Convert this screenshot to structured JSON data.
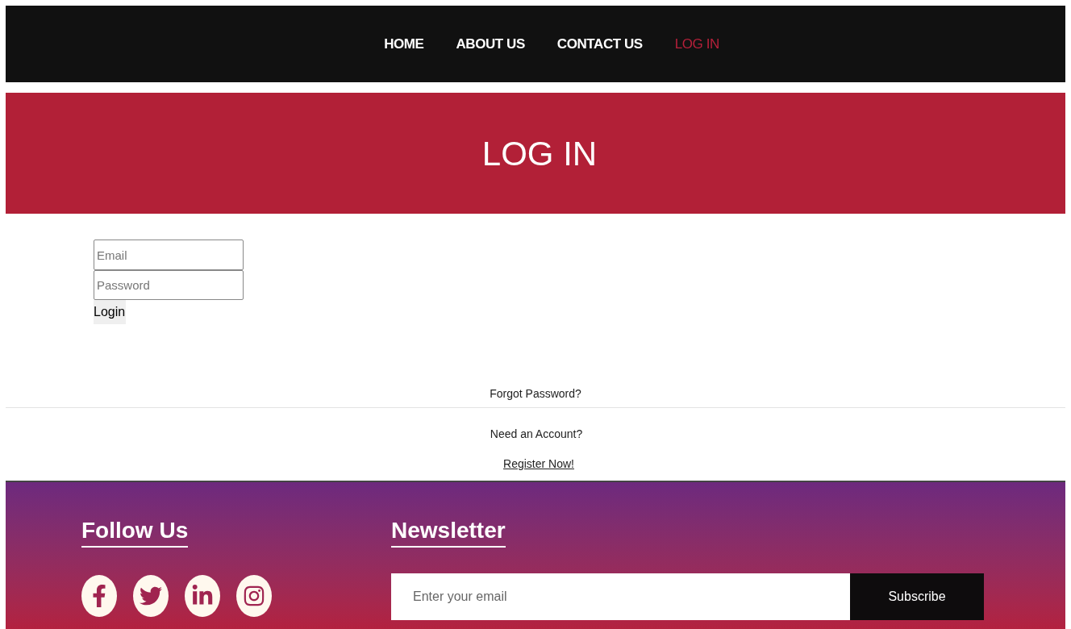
{
  "nav": [
    {
      "label": "HOME",
      "selected": false
    },
    {
      "label": "ABOUT US",
      "selected": false
    },
    {
      "label": "CONTACT US",
      "selected": false
    },
    {
      "label": "LOG IN",
      "selected": true
    }
  ],
  "banner": {
    "title": "LOG IN"
  },
  "login_form": {
    "email": {
      "placeholder": "Email"
    },
    "password": {
      "placeholder": "Password"
    },
    "submit": "Login"
  },
  "forgot_password": "Forgot Password?",
  "need_account": "Need an Account?",
  "register_link": "Register Now!",
  "footer": {
    "follow_title": "Follow Us",
    "social": [
      {
        "kind": "facebook"
      },
      {
        "kind": "twitter"
      },
      {
        "kind": "linkedin"
      },
      {
        "kind": "instagram"
      }
    ],
    "newsletter_title": "Newsletter",
    "newsletter_placeholder": "Enter your email",
    "subscribe": "Subscribe"
  }
}
